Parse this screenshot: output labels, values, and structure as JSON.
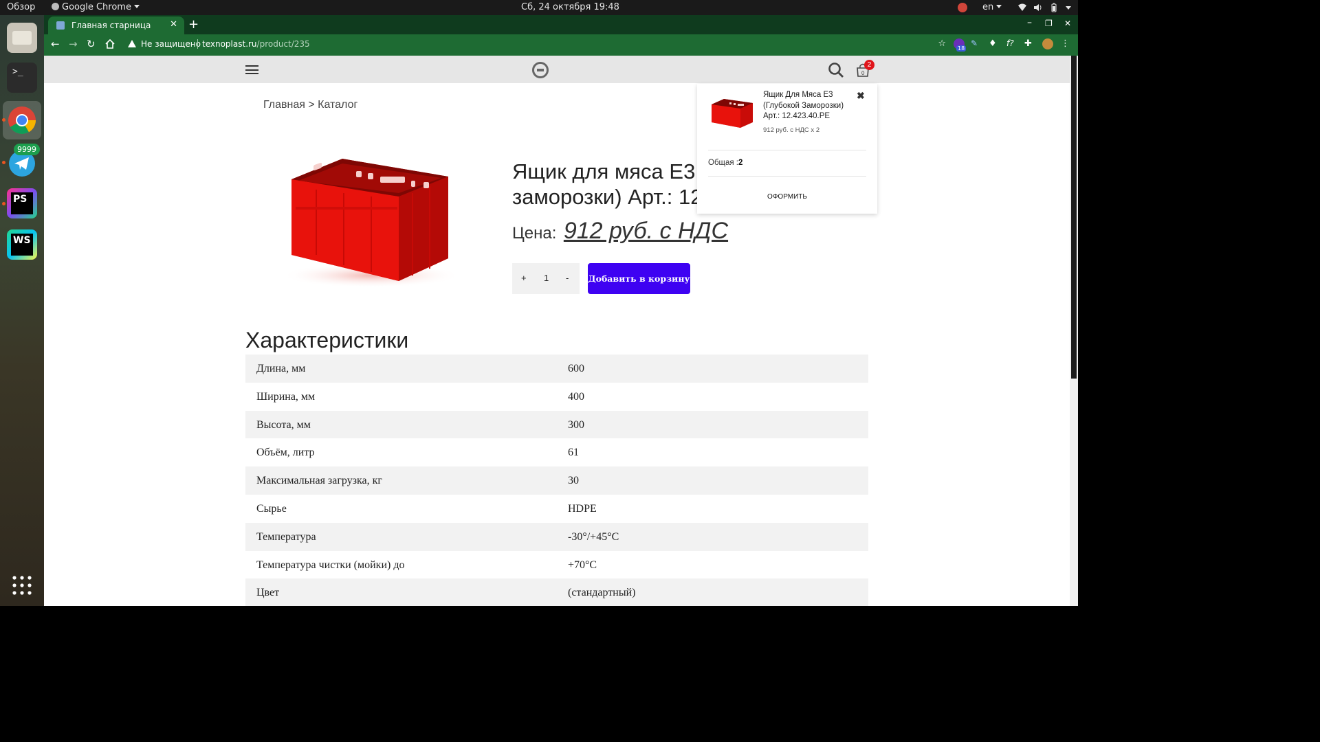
{
  "desktop": {
    "activities": "Обзор",
    "active_app": "Google Chrome",
    "clock": "Сб, 24 октября  19:48",
    "language": "en",
    "telegram_badge": "9999"
  },
  "browser": {
    "tab_title": "Главная старница",
    "security_label": "Не защищено",
    "url_host": "texnoplast.ru",
    "url_path": "/product/235",
    "extension_badge": "18"
  },
  "site": {
    "cart_count": "2",
    "cart_icon_label": "0",
    "breadcrumb": "Главная > Каталог"
  },
  "product": {
    "title_line1": "Ящик для мяса Е3",
    "title_line2": "заморозки) Арт.: 12",
    "price_label": "Цена:",
    "price_value": "912 руб. с НДС",
    "qty_plus": "+",
    "qty_value": "1",
    "qty_minus": "-",
    "add_to_cart": "Добавить в корзину"
  },
  "specs": {
    "title": "Характеристики",
    "rows": [
      {
        "key": "Длина, мм",
        "value": "600"
      },
      {
        "key": "Ширина, мм",
        "value": "400"
      },
      {
        "key": "Высота, мм",
        "value": "300"
      },
      {
        "key": "Объём, литр",
        "value": "61"
      },
      {
        "key": "Максимальная загрузка, кг",
        "value": "30"
      },
      {
        "key": "Сырье",
        "value": "HDPE"
      },
      {
        "key": "Температура",
        "value": "-30°/+45°C"
      },
      {
        "key": "Температура чистки (мойки) до",
        "value": "+70°C"
      },
      {
        "key": "Цвет",
        "value": "(стандартный)"
      }
    ]
  },
  "cart_popup": {
    "item_name_line1": "Ящик Для Мяса Е3",
    "item_name_line2": "(Глубокой Заморозки)",
    "item_article": "Арт.: 12.423.40.РЕ",
    "item_qty": "912 руб. с НДС x 2",
    "close": "✖",
    "total_label": "Общая :",
    "total_value": "2",
    "checkout": "ОФОРМИТЬ"
  },
  "colors": {
    "chrome_green": "#1e6b33",
    "add_button": "#3e02f2",
    "badge_red": "#e0151b",
    "product_red": "#e8120c"
  }
}
